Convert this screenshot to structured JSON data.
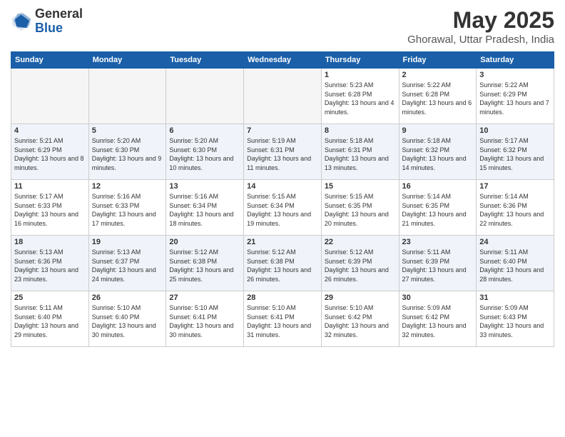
{
  "header": {
    "logo_general": "General",
    "logo_blue": "Blue",
    "month_title": "May 2025",
    "location": "Ghorawal, Uttar Pradesh, India"
  },
  "days_of_week": [
    "Sunday",
    "Monday",
    "Tuesday",
    "Wednesday",
    "Thursday",
    "Friday",
    "Saturday"
  ],
  "weeks": [
    [
      {
        "day": "",
        "empty": true
      },
      {
        "day": "",
        "empty": true
      },
      {
        "day": "",
        "empty": true
      },
      {
        "day": "",
        "empty": true
      },
      {
        "day": "1",
        "sunrise": "5:23 AM",
        "sunset": "6:28 PM",
        "daylight": "13 hours and 4 minutes."
      },
      {
        "day": "2",
        "sunrise": "5:22 AM",
        "sunset": "6:28 PM",
        "daylight": "13 hours and 6 minutes."
      },
      {
        "day": "3",
        "sunrise": "5:22 AM",
        "sunset": "6:29 PM",
        "daylight": "13 hours and 7 minutes."
      }
    ],
    [
      {
        "day": "4",
        "sunrise": "5:21 AM",
        "sunset": "6:29 PM",
        "daylight": "13 hours and 8 minutes."
      },
      {
        "day": "5",
        "sunrise": "5:20 AM",
        "sunset": "6:30 PM",
        "daylight": "13 hours and 9 minutes."
      },
      {
        "day": "6",
        "sunrise": "5:20 AM",
        "sunset": "6:30 PM",
        "daylight": "13 hours and 10 minutes."
      },
      {
        "day": "7",
        "sunrise": "5:19 AM",
        "sunset": "6:31 PM",
        "daylight": "13 hours and 11 minutes."
      },
      {
        "day": "8",
        "sunrise": "5:18 AM",
        "sunset": "6:31 PM",
        "daylight": "13 hours and 13 minutes."
      },
      {
        "day": "9",
        "sunrise": "5:18 AM",
        "sunset": "6:32 PM",
        "daylight": "13 hours and 14 minutes."
      },
      {
        "day": "10",
        "sunrise": "5:17 AM",
        "sunset": "6:32 PM",
        "daylight": "13 hours and 15 minutes."
      }
    ],
    [
      {
        "day": "11",
        "sunrise": "5:17 AM",
        "sunset": "6:33 PM",
        "daylight": "13 hours and 16 minutes."
      },
      {
        "day": "12",
        "sunrise": "5:16 AM",
        "sunset": "6:33 PM",
        "daylight": "13 hours and 17 minutes."
      },
      {
        "day": "13",
        "sunrise": "5:16 AM",
        "sunset": "6:34 PM",
        "daylight": "13 hours and 18 minutes."
      },
      {
        "day": "14",
        "sunrise": "5:15 AM",
        "sunset": "6:34 PM",
        "daylight": "13 hours and 19 minutes."
      },
      {
        "day": "15",
        "sunrise": "5:15 AM",
        "sunset": "6:35 PM",
        "daylight": "13 hours and 20 minutes."
      },
      {
        "day": "16",
        "sunrise": "5:14 AM",
        "sunset": "6:35 PM",
        "daylight": "13 hours and 21 minutes."
      },
      {
        "day": "17",
        "sunrise": "5:14 AM",
        "sunset": "6:36 PM",
        "daylight": "13 hours and 22 minutes."
      }
    ],
    [
      {
        "day": "18",
        "sunrise": "5:13 AM",
        "sunset": "6:36 PM",
        "daylight": "13 hours and 23 minutes."
      },
      {
        "day": "19",
        "sunrise": "5:13 AM",
        "sunset": "6:37 PM",
        "daylight": "13 hours and 24 minutes."
      },
      {
        "day": "20",
        "sunrise": "5:12 AM",
        "sunset": "6:38 PM",
        "daylight": "13 hours and 25 minutes."
      },
      {
        "day": "21",
        "sunrise": "5:12 AM",
        "sunset": "6:38 PM",
        "daylight": "13 hours and 26 minutes."
      },
      {
        "day": "22",
        "sunrise": "5:12 AM",
        "sunset": "6:39 PM",
        "daylight": "13 hours and 26 minutes."
      },
      {
        "day": "23",
        "sunrise": "5:11 AM",
        "sunset": "6:39 PM",
        "daylight": "13 hours and 27 minutes."
      },
      {
        "day": "24",
        "sunrise": "5:11 AM",
        "sunset": "6:40 PM",
        "daylight": "13 hours and 28 minutes."
      }
    ],
    [
      {
        "day": "25",
        "sunrise": "5:11 AM",
        "sunset": "6:40 PM",
        "daylight": "13 hours and 29 minutes."
      },
      {
        "day": "26",
        "sunrise": "5:10 AM",
        "sunset": "6:40 PM",
        "daylight": "13 hours and 30 minutes."
      },
      {
        "day": "27",
        "sunrise": "5:10 AM",
        "sunset": "6:41 PM",
        "daylight": "13 hours and 30 minutes."
      },
      {
        "day": "28",
        "sunrise": "5:10 AM",
        "sunset": "6:41 PM",
        "daylight": "13 hours and 31 minutes."
      },
      {
        "day": "29",
        "sunrise": "5:10 AM",
        "sunset": "6:42 PM",
        "daylight": "13 hours and 32 minutes."
      },
      {
        "day": "30",
        "sunrise": "5:09 AM",
        "sunset": "6:42 PM",
        "daylight": "13 hours and 32 minutes."
      },
      {
        "day": "31",
        "sunrise": "5:09 AM",
        "sunset": "6:43 PM",
        "daylight": "13 hours and 33 minutes."
      }
    ]
  ]
}
